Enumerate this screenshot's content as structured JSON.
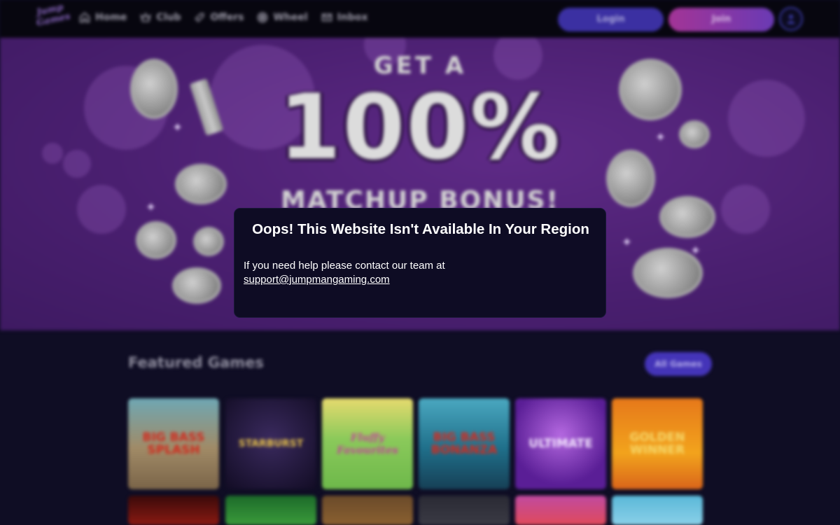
{
  "header": {
    "logo_text_1": "Jump",
    "logo_text_2": "Games",
    "nav": [
      {
        "label": "Home",
        "icon": "home-icon"
      },
      {
        "label": "Club",
        "icon": "crown-icon"
      },
      {
        "label": "Offers",
        "icon": "tag-icon"
      },
      {
        "label": "Wheel",
        "icon": "wheel-icon"
      },
      {
        "label": "Inbox",
        "icon": "mail-icon"
      }
    ],
    "login_label": "Login",
    "join_label": "Join",
    "user_icon": "user-icon"
  },
  "banner": {
    "line1": "GET A",
    "line2": "100%",
    "line3": "MATCHUP BONUS!"
  },
  "featured": {
    "title": "Featured Games",
    "all_games_label": "All Games",
    "games": [
      {
        "name": "BIG BASS SPLASH"
      },
      {
        "name": "STARBURST"
      },
      {
        "name": "Fluffy Favourites"
      },
      {
        "name": "BIG BASS BONANZA"
      },
      {
        "name": "ULTIMATE"
      },
      {
        "name": "GOLDEN WINNER"
      }
    ]
  },
  "modal": {
    "title": "Oops! This Website Isn't Available In Your Region",
    "body": "If you need help please contact our team at",
    "email": "support@jumpmangaming.com"
  },
  "colors": {
    "header_bg": "#07060f",
    "page_bg": "#0f0d24",
    "banner_purple": "#4a1f70",
    "login_btn": "#3b30a2",
    "join_btn_start": "#a33496",
    "join_btn_end": "#6a3ab4",
    "modal_bg": "#0e0c24"
  }
}
